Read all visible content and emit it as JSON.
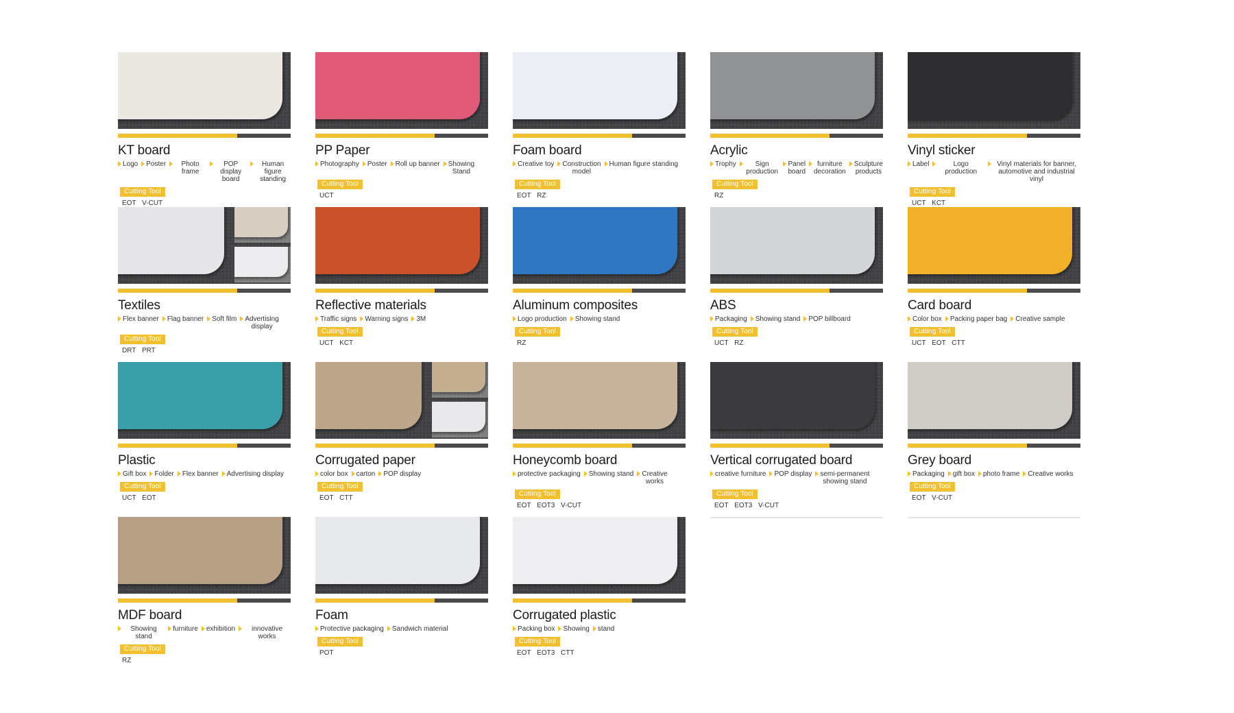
{
  "section": {
    "tool_label": "Cutting Tool"
  },
  "colors": {
    "accent": "#f2c02f",
    "bar_dark": "#4a4a4a",
    "background": "#808183"
  },
  "materials": [
    {
      "name": "KT board",
      "swatch": "#ebe8e3",
      "split": false,
      "apps": [
        "Logo",
        "Poster",
        "Photo frame",
        "POP display\nboard",
        "Human figure\nstanding"
      ],
      "tools": "EOT  V-CUT"
    },
    {
      "name": "PP Paper",
      "swatch": "#e25a7a",
      "split": false,
      "apps": [
        "Photography",
        "Poster",
        "Roll up banner",
        "Showing\nStand"
      ],
      "tools": "UCT"
    },
    {
      "name": "Foam board",
      "swatch": "#eceef5",
      "split": false,
      "apps": [
        "Creative toy",
        "Construction\nmodel",
        "Human figure standing"
      ],
      "tools": "EOT  RZ"
    },
    {
      "name": "Acrylic",
      "swatch": "#909294",
      "split": false,
      "apps": [
        "Trophy",
        "Sign production",
        "Panel\nboard",
        "furniture\ndecoration",
        "Sculpture\nproducts"
      ],
      "tools": "RZ"
    },
    {
      "name": "Vinyl sticker",
      "swatch": "#2d2d30",
      "split": false,
      "apps": [
        "Label",
        "Logo production",
        "Vinyl materials for banner,\nautomotive and industrial vinyl"
      ],
      "tools": "UCT  KCT"
    },
    {
      "name": "Textiles",
      "swatch": "#e6e6e8",
      "split": true,
      "sub1": "#d7cdc1",
      "sub2": "#ececee",
      "apps": [
        "Flex banner",
        "Flag banner",
        "Soft film",
        "Advertising\ndisplay"
      ],
      "tools": "DRT  PRT"
    },
    {
      "name": "Reflective materials",
      "swatch": "#c9522a",
      "split": false,
      "apps": [
        "Traffic signs",
        "Warning signs",
        "3M"
      ],
      "tools": "UCT  KCT"
    },
    {
      "name": "Aluminum       composites",
      "swatch": "#2f77c2",
      "split": false,
      "apps": [
        "Logo production",
        "Showing stand"
      ],
      "tools": "RZ"
    },
    {
      "name": "ABS",
      "swatch": "#d4d5d8",
      "split": false,
      "apps": [
        "Packaging",
        "Showing stand",
        "POP billboard"
      ],
      "tools": "UCT  RZ"
    },
    {
      "name": "Card board",
      "swatch": "#f0b02a",
      "split": false,
      "apps": [
        "Color box",
        "Packing paper bag",
        "Creative sample"
      ],
      "tools": "UCT  EOT  CTT"
    },
    {
      "name": "Plastic",
      "swatch": "#3a9fa8",
      "split": false,
      "apps": [
        "Gift box",
        "Folder",
        "Flex banner",
        "Advertising display"
      ],
      "tools": "UCT  EOT"
    },
    {
      "name": "Corrugated paper",
      "swatch": "#bca588",
      "split": true,
      "sub1": "#c3ae90",
      "sub2": "#e9e9eb",
      "apps": [
        "color box",
        "carton",
        "POP display"
      ],
      "tools": "EOT  CTT"
    },
    {
      "name": "Honeycomb      board",
      "swatch": "#c6b59c",
      "split": false,
      "apps": [
        "protective packaging",
        "Showing stand",
        "Creative\nworks"
      ],
      "tools": "EOT  EOT3  V-CUT"
    },
    {
      "name": "Vertical corrugated board",
      "swatch": "#3b3b3d",
      "split": false,
      "apps": [
        "creative furniture",
        "POP display",
        "semi-permanent\nshowing stand"
      ],
      "tools": "EOT  EOT3  V-CUT"
    },
    {
      "name": "Grey board",
      "swatch": "#cfcbc6",
      "split": false,
      "apps": [
        "Packaging",
        "gift box",
        "photo frame",
        "Creative works"
      ],
      "tools": "EOT  V-CUT"
    },
    {
      "name": "MDF board",
      "swatch": "#b79f85",
      "split": false,
      "apps": [
        "Showing stand",
        "furniture",
        "exhibition",
        "innovative works"
      ],
      "tools": "RZ"
    },
    {
      "name": "Foam",
      "swatch": "#e8e9ec",
      "split": false,
      "apps": [
        "Protective packaging",
        "Sandwich material"
      ],
      "tools": "POT"
    },
    {
      "name": "Corrugated      plastic",
      "swatch": "#eeeef0",
      "split": false,
      "apps": [
        "Packing box",
        "Showing",
        "stand"
      ],
      "tools": "EOT  EOT3  CTT"
    }
  ]
}
